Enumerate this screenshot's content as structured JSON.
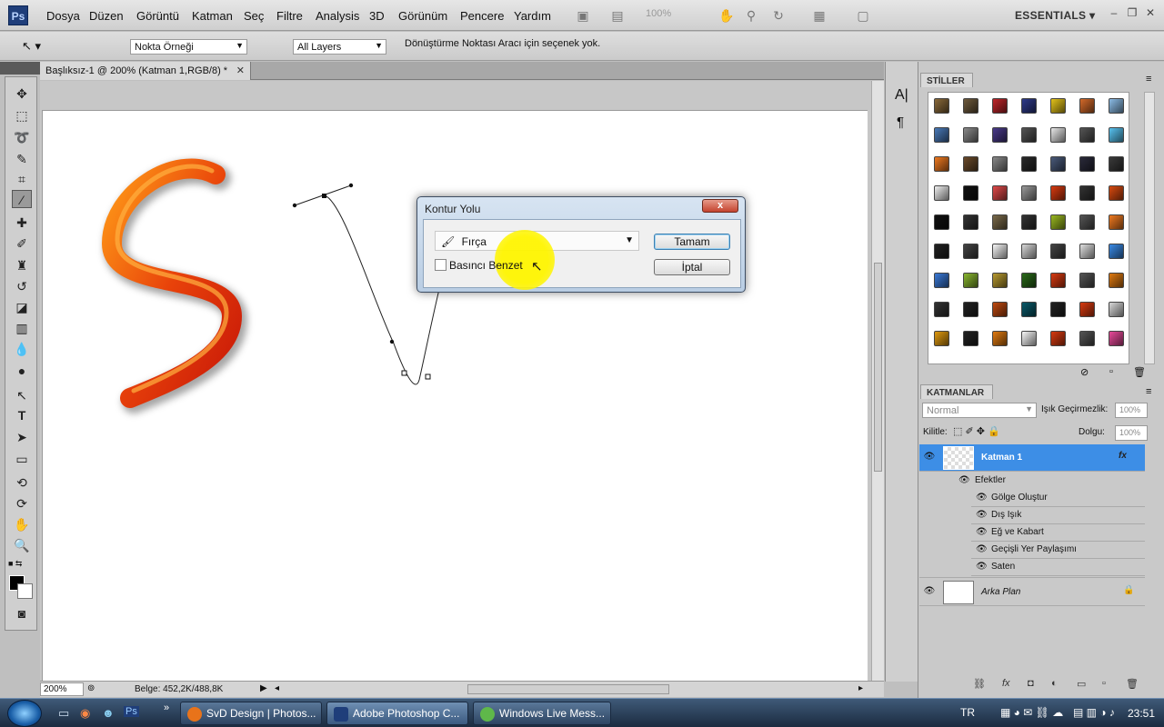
{
  "app": {
    "logo": "Ps",
    "menu": [
      "Dosya",
      "Düzen",
      "Görüntü",
      "Katman",
      "Seç",
      "Filtre",
      "Analysis",
      "3D",
      "Görünüm",
      "Pencere",
      "Yardım"
    ],
    "zoom_display": "100%",
    "workspace": "ESSENTIALS"
  },
  "options": {
    "sample_select": "Nokta Örneği",
    "layers_select": "All Layers",
    "hint": "Dönüştürme Noktası Aracı için seçenek yok."
  },
  "document": {
    "tab_title": "Başlıksız-1 @ 200% (Katman 1,RGB/8) *",
    "zoom": "200%",
    "info": "Belge: 452,2K/488,8K"
  },
  "dialog": {
    "title": "Kontur Yolu",
    "tool_value": "Fırça",
    "pressure_label": "Basıncı Benzet",
    "pressure_checked": false,
    "ok_label": "Tamam",
    "cancel_label": "İptal",
    "close_glyph": "x"
  },
  "styles_panel": {
    "title": "STİLLER",
    "swatch_colors": [
      "#8a6a3a",
      "#6e5a3c",
      "#c0262a",
      "#2e3a8a",
      "#e3c21a",
      "#d46a2a",
      "#8bbce6",
      "#4a7ab8",
      "#8a8a8a",
      "#4a3a8a",
      "#555555",
      "#e8e8e8",
      "#555555",
      "#58c3f0",
      "#f07a20",
      "#6a4a2a",
      "#8a8a8a",
      "#2a2a2a",
      "#4a5a7a",
      "#2a2a3a",
      "#3a3a3a",
      "#f0f0f0",
      "#111111",
      "#e04a4a",
      "#9a9a9a",
      "#d83a10",
      "#333333",
      "#d84a10",
      "#111111",
      "#333333",
      "#7a6a4a",
      "#333333",
      "#9ab820",
      "#555555",
      "#f07a20",
      "#222222",
      "#444444",
      "#f8f8f8",
      "#d8d8d8",
      "#444444",
      "#e0e0e0",
      "#3a8ae6",
      "#3a7ad8",
      "#8ab830",
      "#b89a30",
      "#2a6a1a",
      "#d83a10",
      "#555555",
      "#e07a10",
      "#333333",
      "#222222",
      "#c04a10",
      "#0a5a6a",
      "#222222",
      "#d83a10",
      "#d8d8d8",
      "#e09a10",
      "#222222",
      "#e07a10",
      "#f8f8f8",
      "#d83a10",
      "#555555",
      "#e84a9a"
    ]
  },
  "layers_panel": {
    "title": "KATMANLAR",
    "blend_mode": "Normal",
    "opacity_label": "Işık Geçirmezlik:",
    "opacity_value": "100%",
    "lock_label": "Kilitle:",
    "fill_label": "Dolgu:",
    "fill_value": "100%",
    "layer1_name": "Katman 1",
    "fx_badge": "fx",
    "effects_label": "Efektler",
    "effects": [
      "Gölge Oluştur",
      "Dış Işık",
      "Eğ ve Kabart",
      "Geçişli Yer Paylaşımı",
      "Saten"
    ],
    "background_name": "Arka Plan"
  },
  "taskbar": {
    "buttons": [
      "SvD Design | Photos...",
      "Adobe Photoshop C...",
      "Windows Live Mess..."
    ],
    "language": "TR",
    "time": "23:51"
  }
}
